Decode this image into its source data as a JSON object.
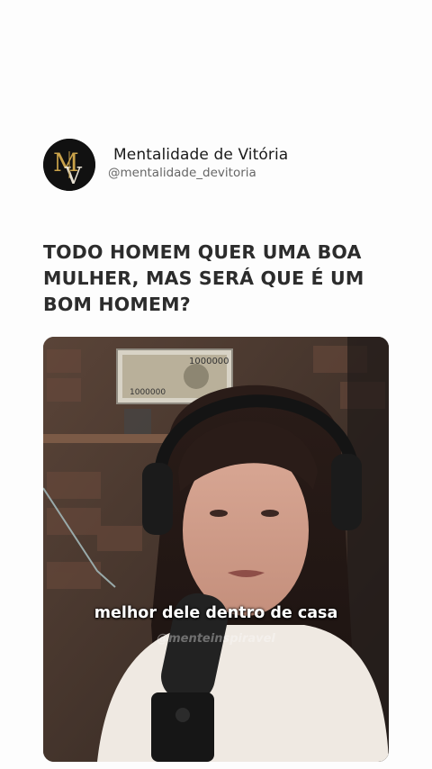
{
  "profile": {
    "name": "Mentalidade de Vitória",
    "handle": "@mentalidade_devitoria",
    "avatar_icon": "mv-monogram-logo",
    "avatar_text": "MV"
  },
  "post": {
    "headline": "TODO HOMEM QUER UMA BOA MULHER, MAS SERÁ QUE É UM BOM HOMEM?"
  },
  "video": {
    "caption": "melhor dele dentro de casa",
    "watermark": "@menteinspiravel",
    "banknote_values": [
      "1000000",
      "1000000"
    ]
  },
  "colors": {
    "background": "#fdfdfd",
    "headline": "#2c2c2c",
    "handle": "#666666",
    "avatar_bg": "#111111",
    "avatar_gold": "#c9a24a"
  }
}
